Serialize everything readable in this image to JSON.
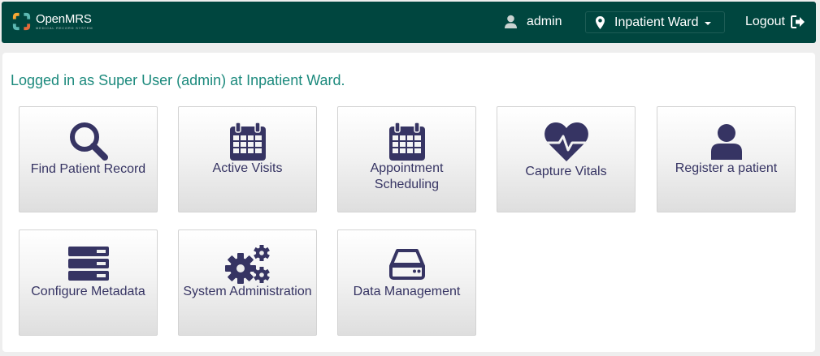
{
  "header": {
    "logo": {
      "name": "OpenMRS",
      "subtitle": "MEDICAL RECORD SYSTEM"
    },
    "user": "admin",
    "location": "Inpatient Ward",
    "logout": "Logout"
  },
  "main": {
    "welcome": "Logged in as Super User (admin) at Inpatient Ward."
  },
  "apps": [
    {
      "label": "Find Patient Record",
      "icon": "search-icon"
    },
    {
      "label": "Active Visits",
      "icon": "calendar-icon"
    },
    {
      "label": "Appointment Scheduling",
      "icon": "calendar-icon"
    },
    {
      "label": "Capture Vitals",
      "icon": "heartbeat-icon"
    },
    {
      "label": "Register a patient",
      "icon": "user-icon"
    },
    {
      "label": "Configure Metadata",
      "icon": "server-icon"
    },
    {
      "label": "System Administration",
      "icon": "gears-icon"
    },
    {
      "label": "Data Management",
      "icon": "hard-drive-icon"
    }
  ],
  "colors": {
    "header_bg": "#00463f",
    "welcome_text": "#1c8a7d",
    "icon": "#363463",
    "page_bg": "#eeeeee"
  }
}
